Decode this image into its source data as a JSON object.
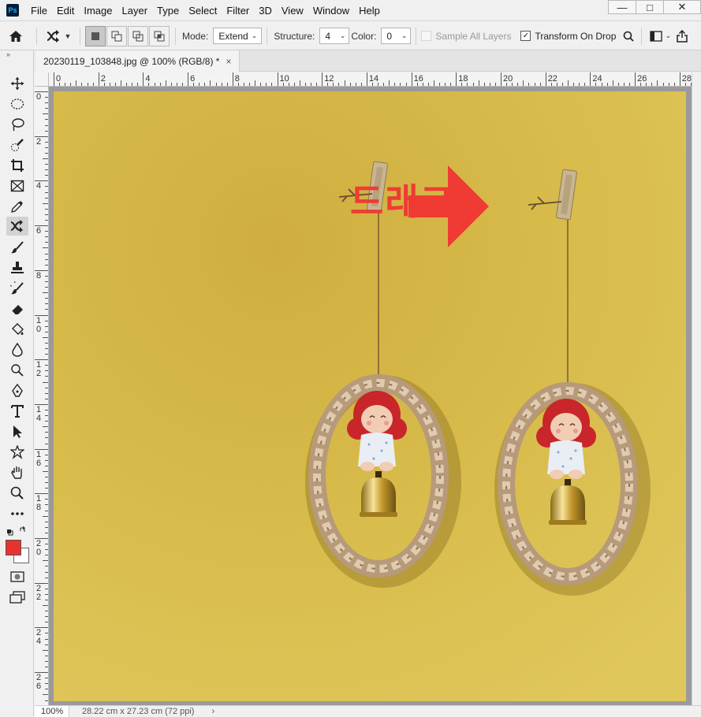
{
  "app": {
    "logo": "Ps"
  },
  "menu": [
    "File",
    "Edit",
    "Image",
    "Layer",
    "Type",
    "Select",
    "Filter",
    "3D",
    "View",
    "Window",
    "Help"
  ],
  "window_controls": {
    "minimize": "—",
    "restore": "□",
    "close": "✕"
  },
  "options": {
    "mode_label": "Mode:",
    "mode_value": "Extend",
    "structure_label": "Structure:",
    "structure_value": "4",
    "color_label": "Color:",
    "color_value": "0",
    "sample_all_layers": "Sample All Layers",
    "transform_on_drop": "Transform On Drop"
  },
  "document": {
    "tab_title": "20230119_103848.jpg @ 100% (RGB/8) *",
    "close_glyph": "×"
  },
  "ruler_top_labels": [
    "0",
    "2",
    "4",
    "6",
    "8",
    "10",
    "12",
    "14",
    "16",
    "18",
    "20",
    "22",
    "24",
    "26",
    "28"
  ],
  "ruler_left_labels": [
    "0",
    "2",
    "4",
    "6",
    "8",
    "10",
    "12",
    "14",
    "16",
    "18",
    "20",
    "22",
    "24",
    "26"
  ],
  "annotation": {
    "text": "드래그",
    "color": "#ef3b34"
  },
  "colors": {
    "foreground": "#e8322d",
    "background": "#ffffff",
    "wall": "#dcc152"
  },
  "status": {
    "zoom": "100%",
    "doc_size": "28.22 cm x 27.23 cm (72 ppi)",
    "arrow": "›"
  },
  "tools": [
    "move-icon",
    "elliptical-marquee-icon",
    "lasso-icon",
    "quick-selection-icon",
    "crop-icon",
    "frame-icon",
    "eyedropper-icon",
    "content-aware-move-icon",
    "brush-icon",
    "clone-stamp-icon",
    "history-brush-icon",
    "eraser-icon",
    "paint-bucket-icon",
    "blur-icon",
    "dodge-icon",
    "pen-icon",
    "type-icon",
    "path-selection-icon",
    "custom-shape-icon",
    "hand-icon",
    "zoom-icon",
    "more-tools-icon"
  ]
}
